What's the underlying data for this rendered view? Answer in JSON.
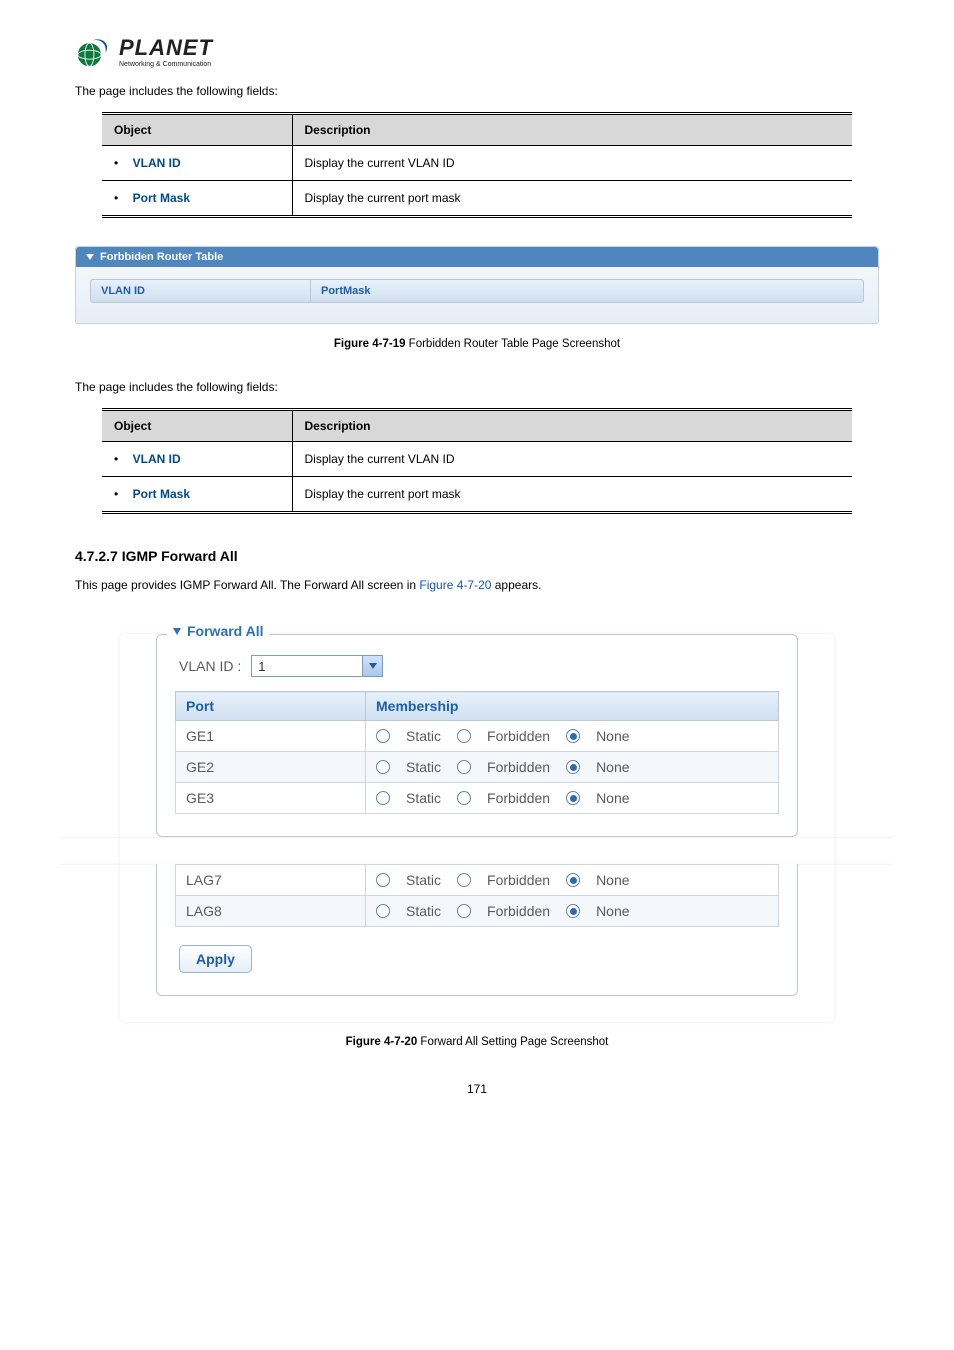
{
  "logo": {
    "name": "PLANET",
    "tagline": "Networking & Communication"
  },
  "intro_line": "The page includes the following fields:",
  "table1": {
    "head_object": "Object",
    "head_desc": "Description",
    "rows": [
      {
        "obj": "VLAN ID",
        "desc": "Display the current VLAN ID"
      },
      {
        "obj": "Port Mask",
        "desc": "Display the current port mask"
      }
    ]
  },
  "forbidden_panel": {
    "title": "Forbbiden Router Table",
    "col1": "VLAN ID",
    "col2": "PortMask"
  },
  "figure1": {
    "label": "Figure 4-7-19",
    "text": " Forbidden Router Table Page Screenshot"
  },
  "intro_line2": "The page includes the following fields:",
  "table2": {
    "head_object": "Object",
    "head_desc": "Description",
    "rows": [
      {
        "obj": "VLAN ID",
        "desc": "Display the current VLAN ID"
      },
      {
        "obj": "Port Mask",
        "desc": "Display the current port mask"
      }
    ]
  },
  "section_heading": "4.7.2.7 IGMP Forward All",
  "section_text_pre": "This page provides IGMP Forward All. The Forward All screen in ",
  "section_text_link": "Figure 4-7-20",
  "section_text_post": " appears.",
  "forward_all": {
    "legend": "Forward All",
    "vlan_label": "VLAN ID :",
    "vlan_value": "1",
    "head_port": "Port",
    "head_membership": "Membership",
    "opt_static": "Static",
    "opt_forbidden": "Forbidden",
    "opt_none": "None",
    "rows_top": [
      {
        "port": "GE1"
      },
      {
        "port": "GE2"
      },
      {
        "port": "GE3"
      }
    ],
    "rows_bottom": [
      {
        "port": "LAG7"
      },
      {
        "port": "LAG8"
      }
    ],
    "apply": "Apply"
  },
  "figure2": {
    "label": "Figure 4-7-20",
    "text": " Forward All Setting Page Screenshot"
  },
  "page_number": "171"
}
